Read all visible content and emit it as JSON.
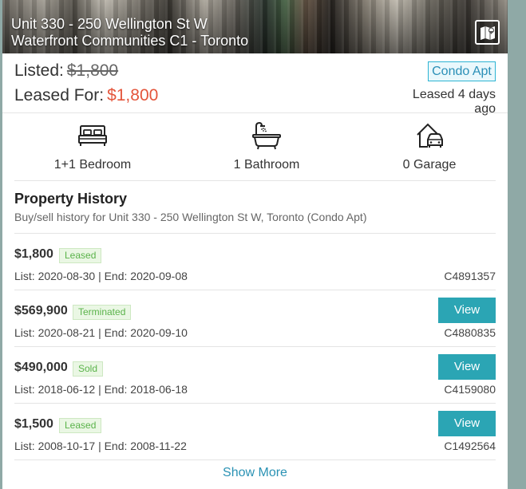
{
  "header": {
    "address_line1": "Unit 330 - 250 Wellington St W",
    "address_line2": "Waterfront Communities C1 - Toronto",
    "map_icon": "map-icon"
  },
  "pricing": {
    "listed_label": "Listed:",
    "listed_price": "$1,800",
    "leased_label": "Leased For:",
    "leased_price": "$1,800",
    "property_type": "Condo Apt",
    "leased_ago": "Leased 4 days ago"
  },
  "features": [
    {
      "icon": "bed-icon",
      "label": "1+1 Bedroom"
    },
    {
      "icon": "bathtub-icon",
      "label": "1 Bathroom"
    },
    {
      "icon": "garage-icon",
      "label": "0 Garage"
    }
  ],
  "history": {
    "title": "Property History",
    "subtitle": "Buy/sell history for Unit 330 - 250 Wellington St W, Toronto (Condo Apt)",
    "rows": [
      {
        "price": "$1,800",
        "status": "Leased",
        "dates": "List: 2020-08-30 | End: 2020-09-08",
        "mls": "C4891357",
        "has_view": false
      },
      {
        "price": "$569,900",
        "status": "Terminated",
        "dates": "List: 2020-08-21 | End: 2020-09-10",
        "mls": "C4880835",
        "has_view": true
      },
      {
        "price": "$490,000",
        "status": "Sold",
        "dates": "List: 2018-06-12 | End: 2018-06-18",
        "mls": "C4159080",
        "has_view": true
      },
      {
        "price": "$1,500",
        "status": "Leased",
        "dates": "List: 2008-10-17 | End: 2008-11-22",
        "mls": "C1492564",
        "has_view": true
      }
    ],
    "view_label": "View",
    "show_more": "Show More"
  },
  "colors": {
    "accent": "#2ba5b4",
    "price_red": "#e4553b",
    "badge_green": "#5ab34a",
    "link_blue": "#2a92b4"
  }
}
